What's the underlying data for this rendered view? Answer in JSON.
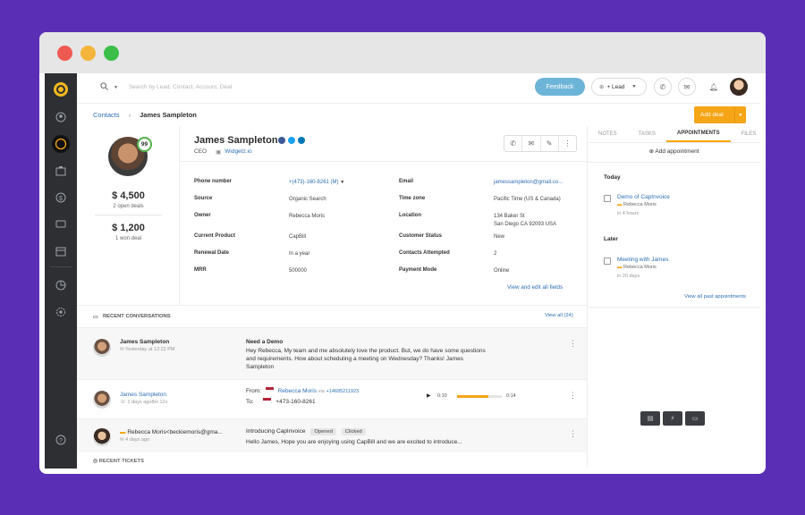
{
  "window": {
    "controls": [
      "close",
      "minimize",
      "maximize"
    ]
  },
  "sidebar": {
    "icons": [
      "logo-icon",
      "contacts-icon",
      "leads-icon",
      "accounts-icon",
      "deals-icon",
      "conversations-icon",
      "calendar-icon",
      "reports-icon",
      "settings-icon",
      "help-icon"
    ]
  },
  "topbar": {
    "search_placeholder": "Search by Lead, Contact, Account, Deal",
    "feedback_label": "Feedback",
    "lead_label": "+ Lead"
  },
  "breadcrumb": {
    "root": "Contacts",
    "separator": "›",
    "current": "James Sampleton"
  },
  "add_deal_label": "Add deal",
  "profile": {
    "score": "99",
    "open_value": "$ 4,500",
    "open_label": "2 open deals",
    "won_value": "$ 1,200",
    "won_label": "1 won deal"
  },
  "contact": {
    "name": "James Sampleton",
    "role": "CEO",
    "company": "Widgetz.io"
  },
  "fields": {
    "phone_label": "Phone number",
    "phone_value": "+(473)-160-8261 (M)",
    "email_label": "Email",
    "email_value": "jamessampleton@gmail.co...",
    "source_label": "Source",
    "source_value": "Organic Search",
    "timezone_label": "Time zone",
    "timezone_value": "Pacific Time (US & Canada)",
    "owner_label": "Owner",
    "owner_value": "Rebecca Moris",
    "location_label": "Location",
    "location_line1": "134 Baker St",
    "location_line2": "San Diego CA 92093 USA",
    "product_label": "Current Product",
    "product_value": "CapBill",
    "status_label": "Customer Status",
    "status_value": "New",
    "renewal_label": "Renewal Date",
    "renewal_value": "In a year",
    "attempted_label": "Contacts Attempted",
    "attempted_value": "2",
    "mrr_label": "MRR",
    "mrr_value": "500000",
    "payment_label": "Payment Mode",
    "payment_value": "Online",
    "view_edit_label": "View and edit all fields"
  },
  "conversations": {
    "title": "RECENT CONVERSATIONS",
    "view_all": "View all (24)",
    "items": [
      {
        "name": "James Sampleton",
        "meta": "Yesterday at 12:22 PM",
        "subject": "Need a Demo",
        "body": "Hey Rebecca, My team and me absolutely love the product. But, we do have some questions and requirements. How about scheduling a meeting on Wednesday? Thanks! James Sampleton"
      },
      {
        "name": "James Sampleton",
        "meta": "2 days ago8m 12s",
        "from_label": "From:",
        "from_name": "Rebecca Moris",
        "from_via": "via",
        "from_number": "+14695211923",
        "to_label": "To:",
        "to_number": "+473-160-8261",
        "time_start": "0:10",
        "time_end": "0:14",
        "progress": 0.7
      },
      {
        "name": "Rebecca Moris<beckiemoris@gma...",
        "meta": "4 days ago",
        "subject": "Introducing CapInvoice",
        "tag1": "Opened",
        "tag2": "Clicked",
        "body": "Hello James, Hope you are enjoying using CapBill and we are excited to introduce..."
      }
    ],
    "tickets_title": "RECENT TICKETS"
  },
  "right_panel": {
    "tabs": [
      "NOTES",
      "TASKS",
      "APPOINTMENTS",
      "FILES"
    ],
    "active_tab": "APPOINTMENTS",
    "add_appointment": "Add appointment",
    "today_label": "Today",
    "later_label": "Later",
    "appt1_title": "Demo of CapInvoice",
    "appt1_who": "Rebecca Moris",
    "appt1_when": "in 4 hours",
    "appt2_title": "Meeting with James",
    "appt2_who": "Rebecca Moris",
    "appt2_when": "in 20 days",
    "view_past": "View all past appointments"
  },
  "colors": {
    "accent": "#f5a516",
    "link": "#2e6fb5",
    "background": "#5b2fb5",
    "rail": "#2d2f33",
    "feedback": "#6db5d8",
    "score_ring": "#52b34a"
  }
}
